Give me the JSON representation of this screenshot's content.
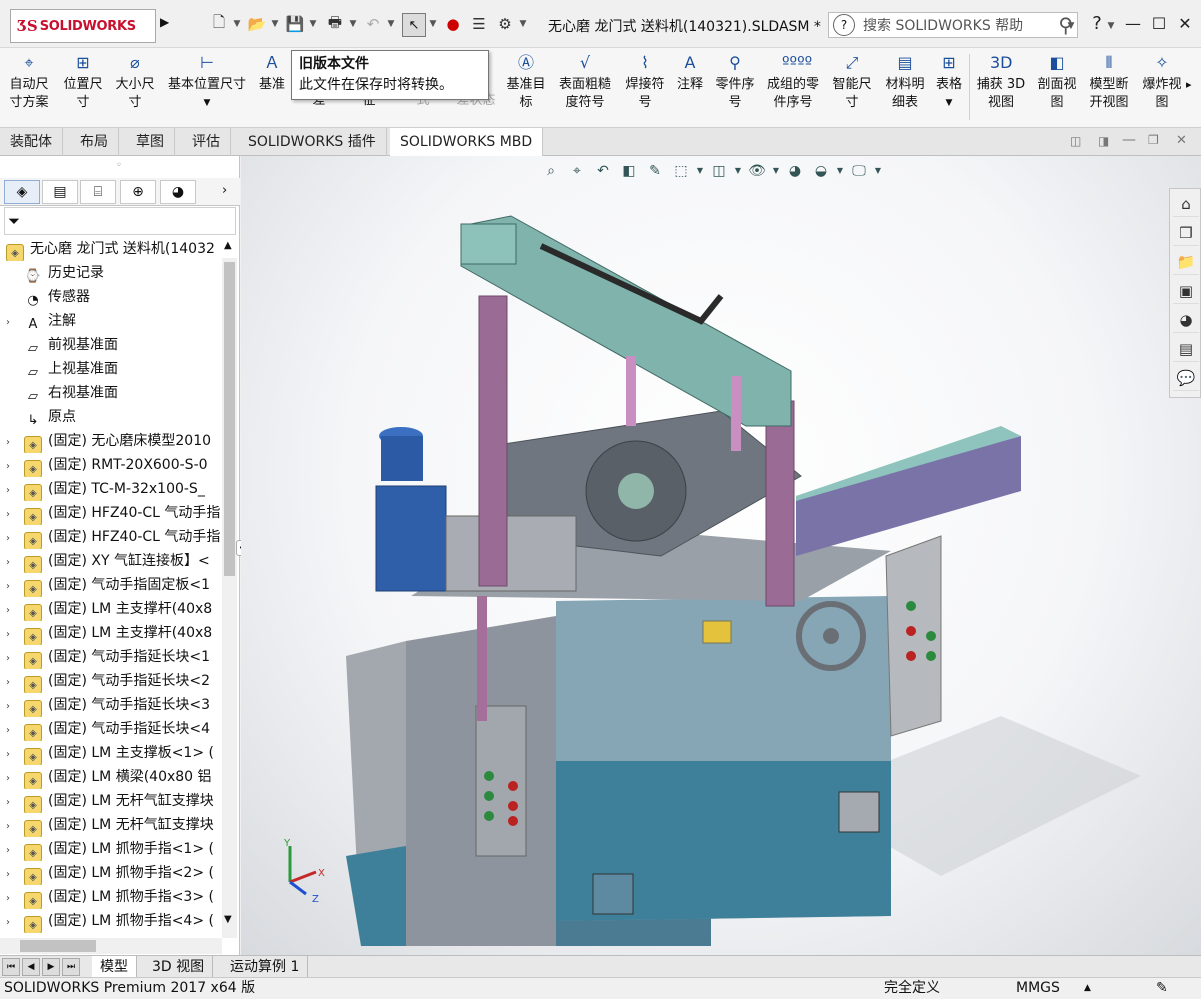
{
  "app": {
    "logo_text": "SOLIDWORKS",
    "doc_title": "无心磨 龙门式 送料机(140321).SLDASM *",
    "search_placeholder": "搜索 SOLIDWORKS 帮助",
    "help_label": "?"
  },
  "tooltip": {
    "title": "旧版本文件",
    "body": "此文件在保存时将转换。"
  },
  "ribbon": {
    "buttons": [
      {
        "line1": "自动尺",
        "line2": "寸方案",
        "icon": "auto-dimension-icon"
      },
      {
        "line1": "位置尺",
        "line2": "寸",
        "icon": "location-dimension-icon"
      },
      {
        "line1": "大小尺",
        "line2": "寸",
        "icon": "size-dimension-icon"
      },
      {
        "line1": "基本位置尺寸",
        "line2": "",
        "icon": "basic-location-icon"
      },
      {
        "line1": "基准",
        "line2": "",
        "icon": "datum-icon"
      },
      {
        "line1": "",
        "line2": "差",
        "icon": "tolerance-icon"
      },
      {
        "line1": "",
        "line2": "征",
        "icon": "feature-icon"
      },
      {
        "line1": "",
        "line2": "式",
        "icon": "format-icon"
      },
      {
        "line1": "",
        "line2": "差状态",
        "icon": "tolerance-status-icon"
      },
      {
        "line1": "基准目",
        "line2": "标",
        "icon": "datum-target-icon"
      },
      {
        "line1": "表面粗糙",
        "line2": "度符号",
        "icon": "surface-finish-icon"
      },
      {
        "line1": "焊接符",
        "line2": "号",
        "icon": "weld-symbol-icon"
      },
      {
        "line1": "注释",
        "line2": "",
        "icon": "note-icon"
      },
      {
        "line1": "零件序",
        "line2": "号",
        "icon": "balloon-icon"
      },
      {
        "line1": "成组的零",
        "line2": "件序号",
        "icon": "stacked-balloon-icon"
      },
      {
        "line1": "智能尺",
        "line2": "寸",
        "icon": "smart-dimension-icon"
      },
      {
        "line1": "材料明",
        "line2": "细表",
        "icon": "bom-icon"
      },
      {
        "line1": "表格",
        "line2": "",
        "icon": "table-icon"
      },
      {
        "line1": "捕获 3D",
        "line2": "视图",
        "icon": "capture-3d-view-icon"
      },
      {
        "line1": "剖面视",
        "line2": "图",
        "icon": "section-view-icon"
      },
      {
        "line1": "模型断",
        "line2": "开视图",
        "icon": "model-break-view-icon"
      },
      {
        "line1": "爆炸视",
        "line2": "图",
        "icon": "exploded-view-icon"
      }
    ]
  },
  "command_tabs": [
    "装配体",
    "布局",
    "草图",
    "评估",
    "SOLIDWORKS 插件",
    "SOLIDWORKS MBD"
  ],
  "feature_tree": {
    "root": "无心磨 龙门式 送料机(14032",
    "items": [
      {
        "label": "历史记录",
        "icon": "history-icon",
        "expand": false
      },
      {
        "label": "传感器",
        "icon": "sensor-icon",
        "expand": false
      },
      {
        "label": "注解",
        "icon": "annotation-icon",
        "expand": true
      },
      {
        "label": "前视基准面",
        "icon": "plane-icon",
        "expand": false
      },
      {
        "label": "上视基准面",
        "icon": "plane-icon",
        "expand": false
      },
      {
        "label": "右视基准面",
        "icon": "plane-icon",
        "expand": false
      },
      {
        "label": "原点",
        "icon": "origin-icon",
        "expand": false
      },
      {
        "label": "(固定) 无心磨床模型2010",
        "icon": "assembly-icon",
        "expand": true
      },
      {
        "label": "(固定) RMT-20X600-S-0",
        "icon": "assembly-icon",
        "expand": true
      },
      {
        "label": "(固定) TC-M-32x100-S_",
        "icon": "assembly-icon",
        "expand": true
      },
      {
        "label": "(固定) HFZ40-CL 气动手指",
        "icon": "assembly-icon",
        "expand": true
      },
      {
        "label": "(固定) HFZ40-CL 气动手指",
        "icon": "assembly-icon",
        "expand": true
      },
      {
        "label": "(固定) XY 气缸连接板】<",
        "icon": "assembly-icon",
        "expand": true
      },
      {
        "label": "(固定) 气动手指固定板<1",
        "icon": "assembly-icon",
        "expand": true
      },
      {
        "label": "(固定) LM 主支撑杆(40x8",
        "icon": "assembly-icon",
        "expand": true
      },
      {
        "label": "(固定) LM 主支撑杆(40x8",
        "icon": "assembly-icon",
        "expand": true
      },
      {
        "label": "(固定) 气动手指延长块<1",
        "icon": "assembly-icon",
        "expand": true
      },
      {
        "label": "(固定) 气动手指延长块<2",
        "icon": "assembly-icon",
        "expand": true
      },
      {
        "label": "(固定) 气动手指延长块<3",
        "icon": "assembly-icon",
        "expand": true
      },
      {
        "label": "(固定) 气动手指延长块<4",
        "icon": "assembly-icon",
        "expand": true
      },
      {
        "label": "(固定) LM 主支撑板<1> (",
        "icon": "assembly-icon",
        "expand": true
      },
      {
        "label": "(固定) LM 横梁(40x80 铝",
        "icon": "assembly-icon",
        "expand": true
      },
      {
        "label": "(固定) LM 无杆气缸支撑块",
        "icon": "assembly-icon",
        "expand": true
      },
      {
        "label": "(固定) LM 无杆气缸支撑块",
        "icon": "assembly-icon",
        "expand": true
      },
      {
        "label": "(固定) LM 抓物手指<1> (",
        "icon": "assembly-icon",
        "expand": true
      },
      {
        "label": "(固定) LM 抓物手指<2> (",
        "icon": "assembly-icon",
        "expand": true
      },
      {
        "label": "(固定) LM 抓物手指<3> (",
        "icon": "assembly-icon",
        "expand": true
      },
      {
        "label": "(固定) LM 抓物手指<4> (",
        "icon": "assembly-icon",
        "expand": true
      }
    ]
  },
  "triad": {
    "x": "X",
    "y": "Y",
    "z": "Z"
  },
  "bottom_tabs": [
    "模型",
    "3D 视图",
    "运动算例 1"
  ],
  "status": {
    "product": "SOLIDWORKS Premium 2017 x64 版",
    "definition": "完全定义",
    "units": "MMGS"
  }
}
